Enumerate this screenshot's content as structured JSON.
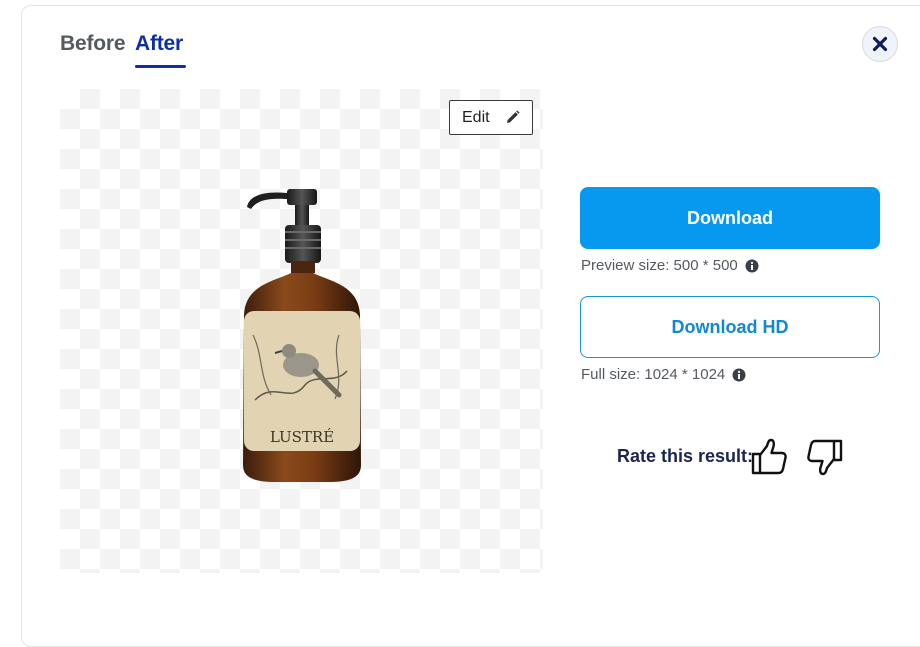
{
  "tabs": {
    "before": "Before",
    "after": "After",
    "active": "After"
  },
  "close": {
    "icon": "close-icon"
  },
  "editor": {
    "edit_label": "Edit",
    "icon": "pencil-icon"
  },
  "product": {
    "label_text": "LUSTRÉ"
  },
  "download": {
    "label": "Download",
    "preview_prefix": "Preview size:",
    "preview_size": "500 * 500"
  },
  "download_hd": {
    "label": "Download HD",
    "full_prefix": "Full size:",
    "full_size": "1024 * 1024"
  },
  "rating": {
    "label": "Rate this result:",
    "up_icon": "thumbs-up-icon",
    "down_icon": "thumbs-down-icon"
  },
  "colors": {
    "accent": "#0d2fa3",
    "primary_button": "#0798ef",
    "outline_button": "#1c94d6"
  }
}
